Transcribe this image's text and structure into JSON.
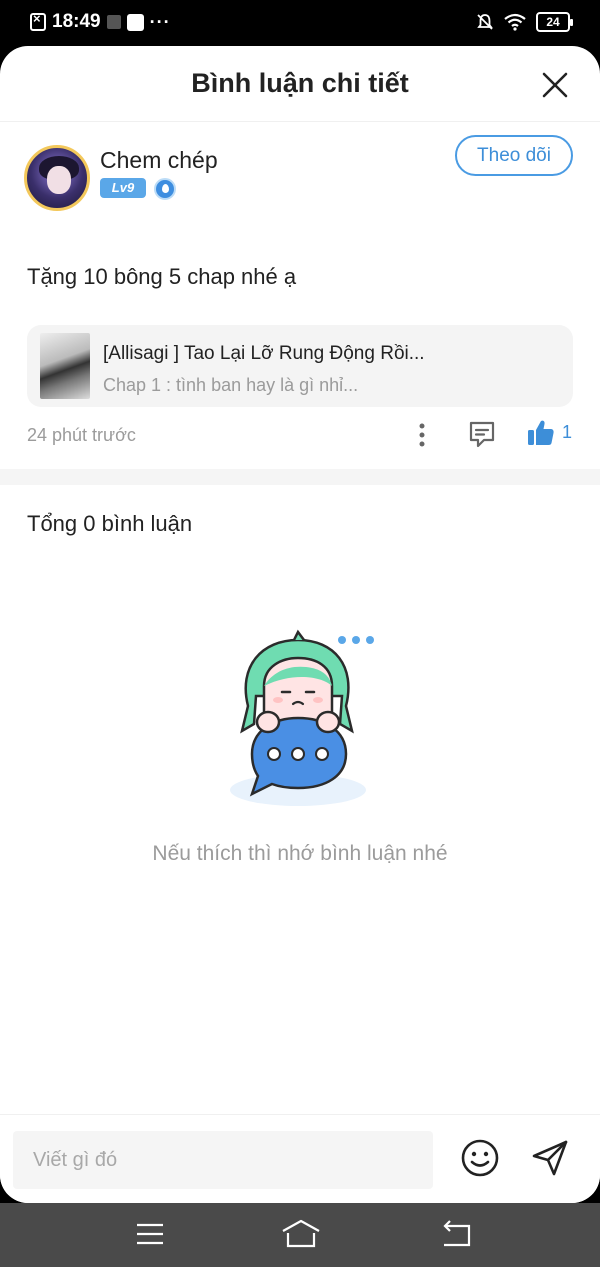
{
  "status_bar": {
    "time": "18:49",
    "dots": "···",
    "battery": "24"
  },
  "header": {
    "title": "Bình luận chi tiết"
  },
  "post": {
    "username": "Chem chép",
    "level": "Lv9",
    "follow_label": "Theo dõi",
    "text": "Tặng 10 bông 5 chap nhé ạ",
    "manga": {
      "title": "[Allisagi ] Tao Lại Lỡ Rung Động Rồi...",
      "chapter": "Chap 1 : tình ban hay là gì nhỉ..."
    },
    "time_ago": "24 phút trước",
    "like_count": "1"
  },
  "comments": {
    "total_label": "Tổng 0 bình luận",
    "empty_message": "Nếu thích thì nhớ bình luận nhé"
  },
  "input": {
    "placeholder": "Viết gì đó"
  },
  "colors": {
    "accent": "#3d8ed8",
    "mascot_hair": "#6fdcb1",
    "bubble": "#4a8fe4"
  }
}
